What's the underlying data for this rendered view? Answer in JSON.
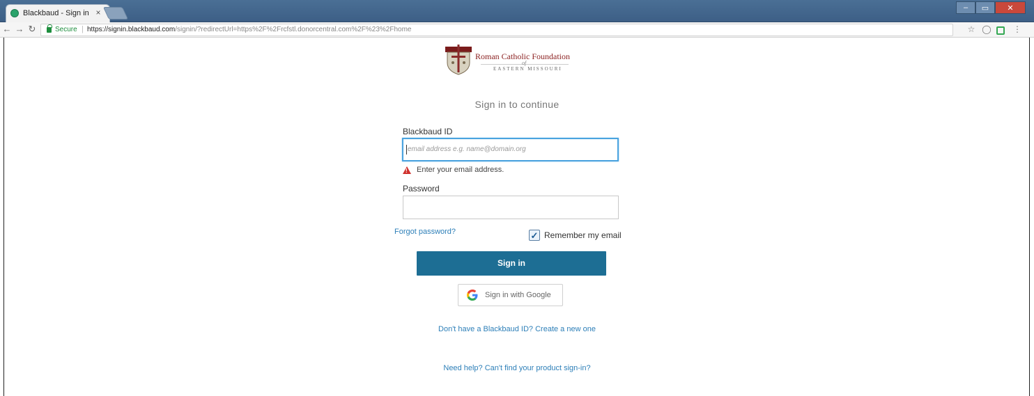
{
  "browser": {
    "tab_title": "Blackbaud - Sign in",
    "tab_close": "×",
    "secure_label": "Secure",
    "url_host": "https://signin.blackbaud.com",
    "url_path": "/signin/?redirectUrl=https%2F%2Frcfstl.donorcentral.com%2F%23%2Fhome",
    "controls": {
      "minimize": "–",
      "maximize": "▭",
      "close": "✕"
    }
  },
  "org": {
    "name": "Roman Catholic Foundation",
    "of": "of",
    "sub": "EASTERN MISSOURI"
  },
  "form": {
    "heading": "Sign in to continue",
    "id_label": "Blackbaud ID",
    "email_placeholder": "email address e.g. name@domain.org",
    "error_text": "Enter your email address.",
    "password_label": "Password",
    "forgot_link": "Forgot password?",
    "remember_label": "Remember my email",
    "remember_checked": true,
    "signin_button": "Sign in",
    "google_button": "Sign in with Google",
    "create_link": "Don't have a Blackbaud ID? Create a new one",
    "help_link": "Need help? Can't find your product sign-in?"
  },
  "colors": {
    "primary_button": "#1d6e94",
    "link": "#2d7fb8",
    "error": "#d0312d",
    "focus_border": "#4aa3df"
  }
}
